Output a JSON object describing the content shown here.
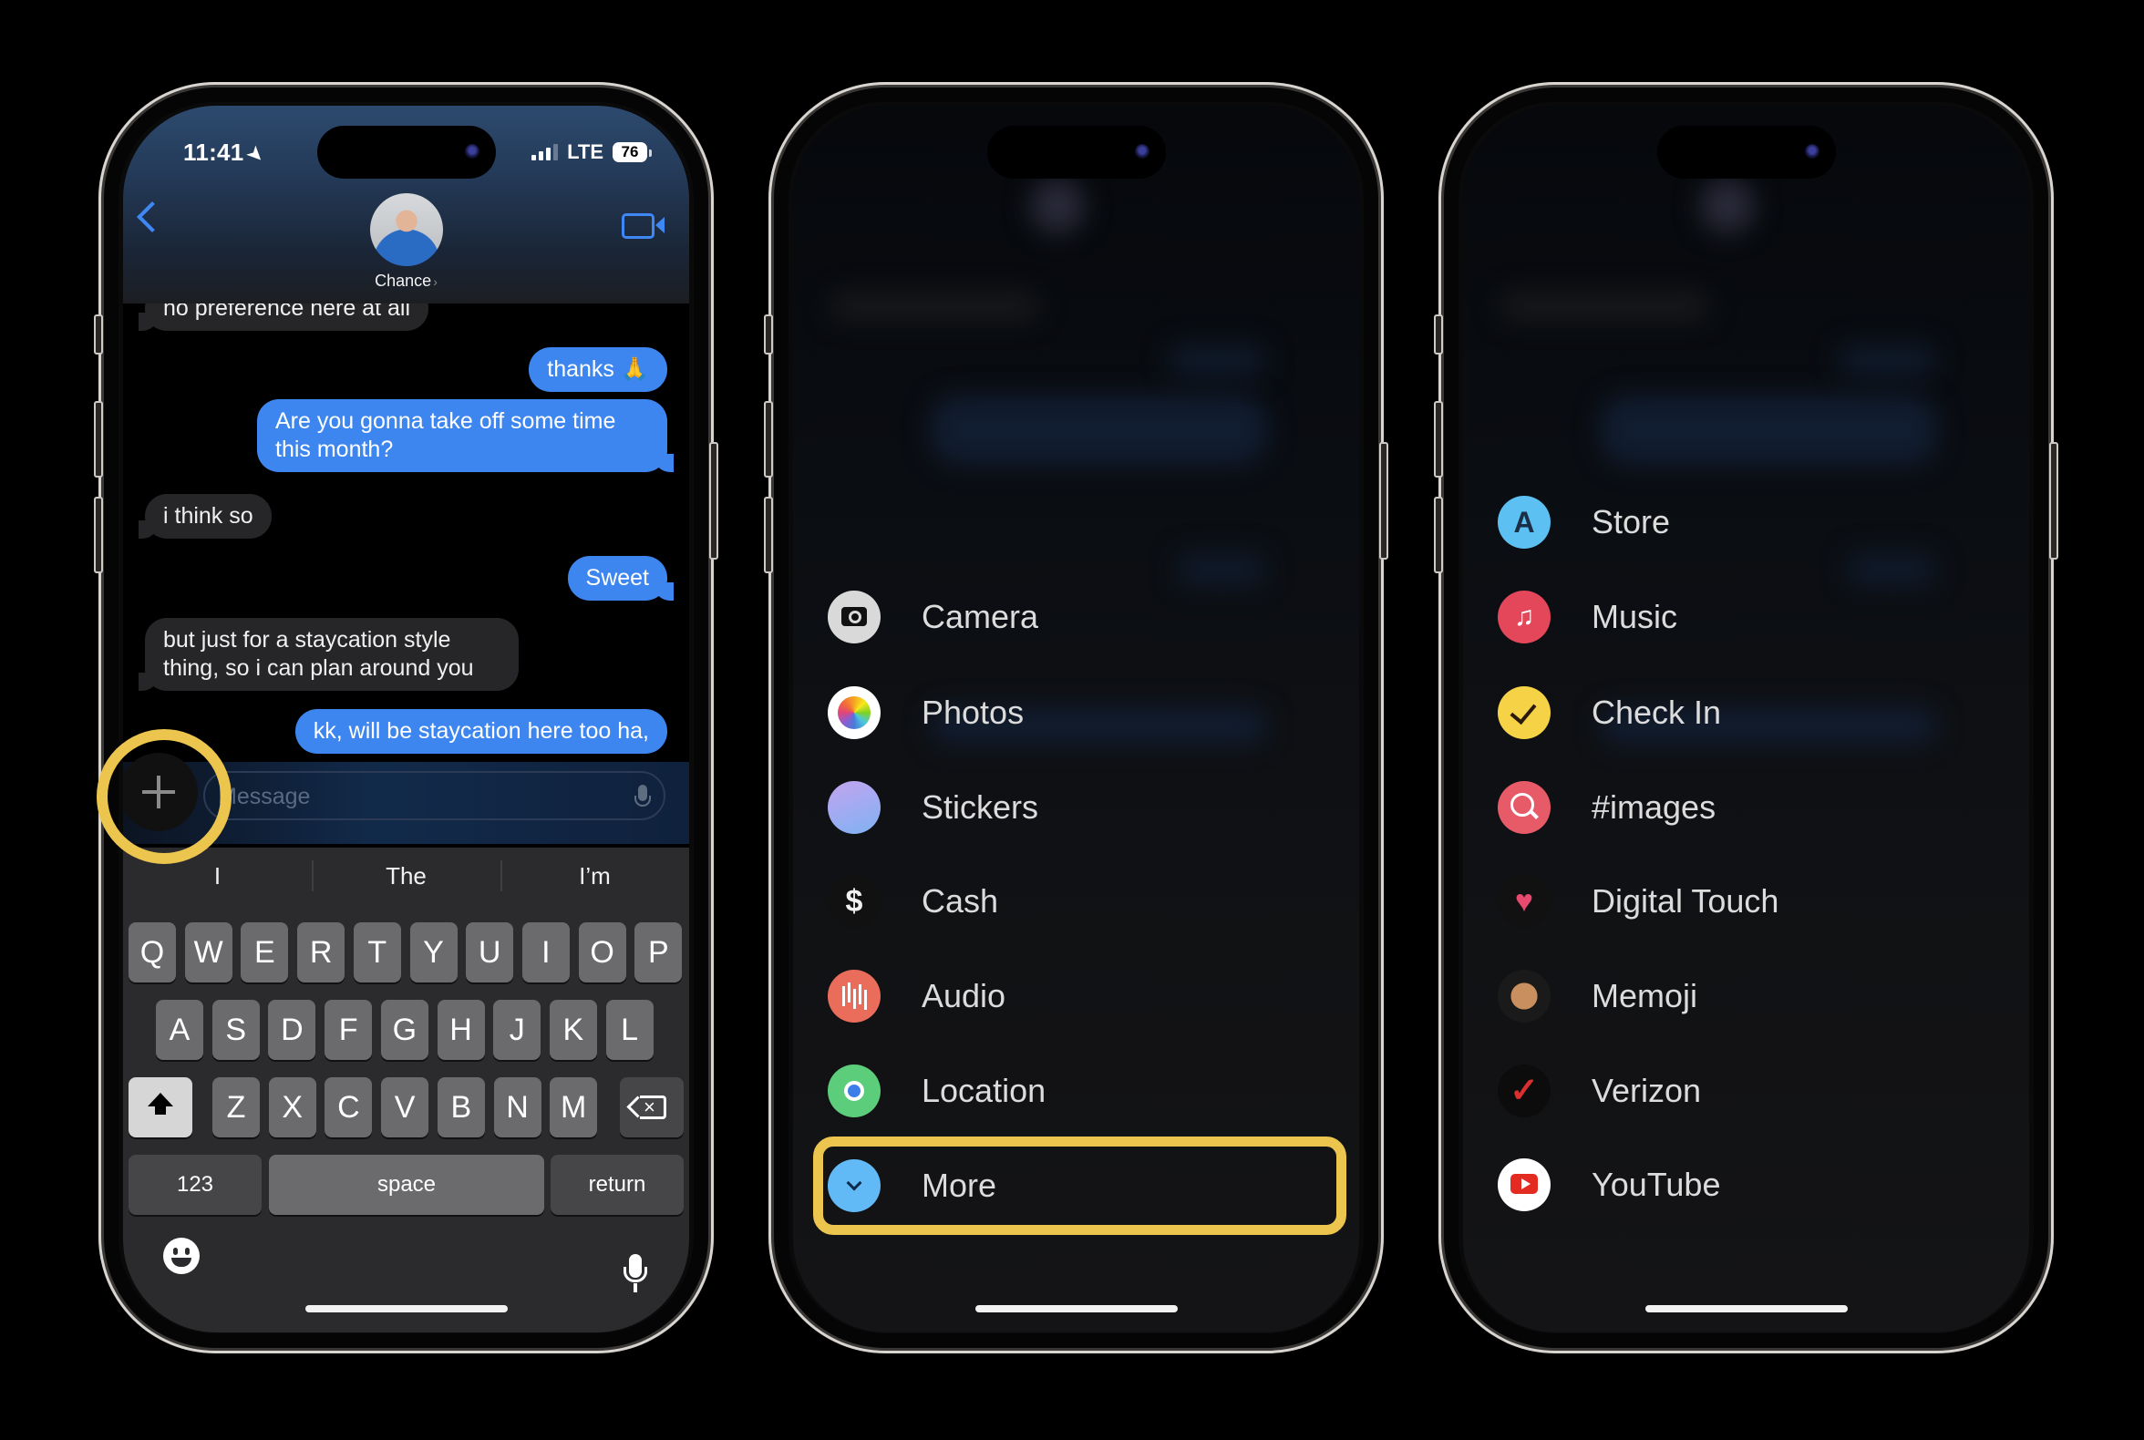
{
  "phone1": {
    "status": {
      "time": "11:41",
      "network": "LTE",
      "battery": "76",
      "signal_bars": 3
    },
    "header": {
      "contact_name": "Chance"
    },
    "messages": [
      {
        "from": "them",
        "text": "no preference here at all"
      },
      {
        "from": "me",
        "text": "thanks 🙏"
      },
      {
        "from": "me",
        "text": "Are you gonna take off some time this month?"
      },
      {
        "from": "them",
        "text": "i think so"
      },
      {
        "from": "me",
        "text": "Sweet"
      },
      {
        "from": "them",
        "text": "but just for a staycation style thing, so i can plan around you"
      },
      {
        "from": "me",
        "text": "kk, will be staycation here too ha,"
      }
    ],
    "compose": {
      "placeholder": "Message"
    },
    "keyboard": {
      "suggestions": [
        "I",
        "The",
        "I’m"
      ],
      "row1": [
        "Q",
        "W",
        "E",
        "R",
        "T",
        "Y",
        "U",
        "I",
        "O",
        "P"
      ],
      "row2": [
        "A",
        "S",
        "D",
        "F",
        "G",
        "H",
        "J",
        "K",
        "L"
      ],
      "row3": [
        "Z",
        "X",
        "C",
        "V",
        "B",
        "N",
        "M"
      ],
      "numbers_label": "123",
      "space_label": "space",
      "return_label": "return"
    },
    "highlight_color": "#ECC54F"
  },
  "phone2": {
    "menu": [
      {
        "label": "Camera",
        "icon": "camera-icon"
      },
      {
        "label": "Photos",
        "icon": "photos-icon"
      },
      {
        "label": "Stickers",
        "icon": "stickers-icon"
      },
      {
        "label": "Cash",
        "icon": "cash-icon",
        "glyph": "$"
      },
      {
        "label": "Audio",
        "icon": "audio-icon"
      },
      {
        "label": "Location",
        "icon": "location-icon"
      },
      {
        "label": "More",
        "icon": "more-chevron-icon"
      }
    ]
  },
  "phone3": {
    "menu": [
      {
        "label": "Store",
        "icon": "app-store-icon",
        "glyph": "A"
      },
      {
        "label": "Music",
        "icon": "music-icon",
        "glyph": "♫"
      },
      {
        "label": "Check In",
        "icon": "check-in-icon"
      },
      {
        "label": "#images",
        "icon": "images-search-icon"
      },
      {
        "label": "Digital Touch",
        "icon": "digital-touch-icon",
        "glyph": "♥"
      },
      {
        "label": "Memoji",
        "icon": "memoji-icon"
      },
      {
        "label": "Verizon",
        "icon": "verizon-icon",
        "glyph": "✓"
      },
      {
        "label": "YouTube",
        "icon": "youtube-icon"
      }
    ]
  }
}
